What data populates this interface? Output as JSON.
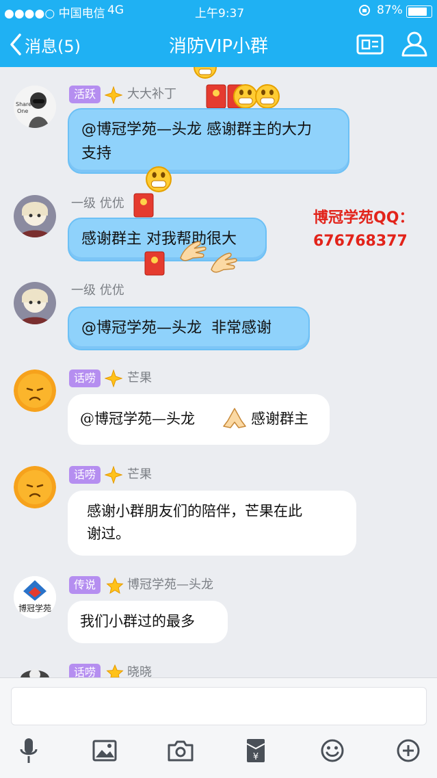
{
  "status": {
    "carrier": "●●●●○ 中国电信",
    "network": "4G",
    "time": "上午9:37",
    "battery": "87%"
  },
  "nav": {
    "back_label": "消息(5)",
    "title": "消防VIP小群"
  },
  "messages": [
    {
      "badge": "活跃",
      "sender": "大大补丁",
      "text": "@博冠学苑—头龙 感谢群主的大力支持",
      "text_line1": "@博冠学苑—头龙 感谢群主的大力",
      "text_line2": "支持"
    },
    {
      "badge": "一级",
      "sender": "优优",
      "text": "感谢群主 对我帮助很大"
    },
    {
      "badge": "一级",
      "sender": "优优",
      "text": "@博冠学苑—头龙  非常感谢"
    },
    {
      "badge": "话唠",
      "sender": "芒果",
      "text_before": "@博冠学苑—头龙",
      "text_after": "感谢群主"
    },
    {
      "badge": "话唠",
      "sender": "芒果",
      "text_line1": "感谢小群朋友们的陪伴，芒果在此",
      "text_line2": "谢过。"
    },
    {
      "badge": "传说",
      "sender": "博冠学苑—头龙",
      "text": "我们小群过的最多",
      "avatar_text": "博冠学苑"
    },
    {
      "badge": "话唠",
      "sender": "晓晓"
    }
  ],
  "watermark": {
    "line1": "博冠学苑QQ：",
    "line2": "676768377"
  },
  "toolbar": [
    "mic-icon",
    "image-icon",
    "camera-icon",
    "red-packet-icon",
    "emoji-icon",
    "plus-icon"
  ],
  "colors": {
    "nav": "#1fb1f3",
    "bubble_blue": "#8fd2fb",
    "badge": "#b58ef0",
    "watermark": "#e2231a"
  }
}
